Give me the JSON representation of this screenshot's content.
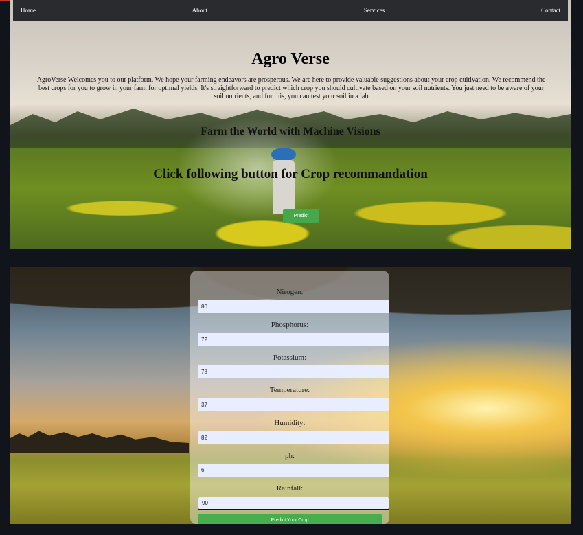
{
  "nav": {
    "items": [
      "Home",
      "About",
      "Services",
      "Contact"
    ]
  },
  "hero": {
    "title": "Agro Verse",
    "intro": "AgroVerse Welcomes you to our platform. We hope your farming endeavors are prosperous. We are here to provide valuable suggestions about your crop cultivation. We recommend the best crops for you to grow in your farm for optimal yields. It's straightforward to predict which crop you should cultivate based on your soil nutrients. You just need to be aware of your soil nutrients, and for this, you can test your soil in a lab",
    "tagline": "Farm the World with Machine Visions",
    "cta": "Click following button for Crop recommandation",
    "predict_label": "Predict"
  },
  "form": {
    "fields": [
      {
        "label": "Nirogen:",
        "value": "80"
      },
      {
        "label": "Phosphorus:",
        "value": "72"
      },
      {
        "label": "Potassium:",
        "value": "78"
      },
      {
        "label": "Temperature:",
        "value": "37"
      },
      {
        "label": "Humidity:",
        "value": "82"
      },
      {
        "label": "ph:",
        "value": "6"
      },
      {
        "label": "Rainfall:",
        "value": "90"
      }
    ],
    "submit_label": "Predict Your Crop"
  },
  "colors": {
    "button_green": "#45a84a",
    "nav_bg": "#2a2b2e",
    "input_bg": "#e8edff"
  }
}
